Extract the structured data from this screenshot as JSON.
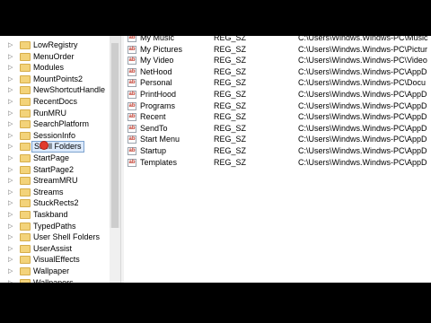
{
  "tree": {
    "items": [
      {
        "label": "LowRegistry"
      },
      {
        "label": "MenuOrder"
      },
      {
        "label": "Modules"
      },
      {
        "label": "MountPoints2"
      },
      {
        "label": "NewShortcutHandle"
      },
      {
        "label": "RecentDocs"
      },
      {
        "label": "RunMRU"
      },
      {
        "label": "SearchPlatform"
      },
      {
        "label": "SessionInfo"
      },
      {
        "label": "Shell Folders",
        "selected": true
      },
      {
        "label": "StartPage"
      },
      {
        "label": "StartPage2"
      },
      {
        "label": "StreamMRU"
      },
      {
        "label": "Streams"
      },
      {
        "label": "StuckRects2"
      },
      {
        "label": "Taskband"
      },
      {
        "label": "TypedPaths"
      },
      {
        "label": "User Shell Folders"
      },
      {
        "label": "UserAssist"
      },
      {
        "label": "VisualEffects"
      },
      {
        "label": "Wallpaper"
      },
      {
        "label": "Wallpapers"
      }
    ]
  },
  "values": {
    "icon_text": "ab",
    "rows": [
      {
        "name": "My Music",
        "type": "REG_SZ",
        "data": "C:\\Users\\Windws.Windws-PC\\Music"
      },
      {
        "name": "My Pictures",
        "type": "REG_SZ",
        "data": "C:\\Users\\Windws.Windws-PC\\Pictur"
      },
      {
        "name": "My Video",
        "type": "REG_SZ",
        "data": "C:\\Users\\Windws.Windws-PC\\Video"
      },
      {
        "name": "NetHood",
        "type": "REG_SZ",
        "data": "C:\\Users\\Windws.Windws-PC\\AppD"
      },
      {
        "name": "Personal",
        "type": "REG_SZ",
        "data": "C:\\Users\\Windws.Windws-PC\\Docu"
      },
      {
        "name": "PrintHood",
        "type": "REG_SZ",
        "data": "C:\\Users\\Windws.Windws-PC\\AppD"
      },
      {
        "name": "Programs",
        "type": "REG_SZ",
        "data": "C:\\Users\\Windws.Windws-PC\\AppD"
      },
      {
        "name": "Recent",
        "type": "REG_SZ",
        "data": "C:\\Users\\Windws.Windws-PC\\AppD"
      },
      {
        "name": "SendTo",
        "type": "REG_SZ",
        "data": "C:\\Users\\Windws.Windws-PC\\AppD"
      },
      {
        "name": "Start Menu",
        "type": "REG_SZ",
        "data": "C:\\Users\\Windws.Windws-PC\\AppD"
      },
      {
        "name": "Startup",
        "type": "REG_SZ",
        "data": "C:\\Users\\Windws.Windws-PC\\AppD"
      },
      {
        "name": "Templates",
        "type": "REG_SZ",
        "data": "C:\\Users\\Windws.Windws-PC\\AppD"
      }
    ]
  }
}
